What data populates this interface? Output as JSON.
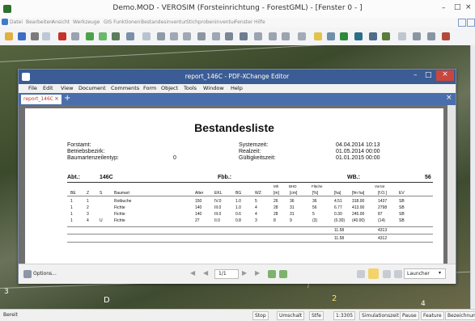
{
  "app": {
    "title": "Demo.MOD - VEROSIM (Forsteinrichtung - ForestGML) - [Fenster 0 - ]",
    "menu": [
      "Datei",
      "Bearbeiten",
      "Ansicht",
      "Werkzeuge",
      "GIS Funktionen",
      "Bestandesinventur",
      "Stichprobeninventur",
      "Fenster",
      "Hilfe"
    ],
    "status": {
      "left": "Bereit",
      "cells": [
        "Stop",
        "Umschalt",
        "Stfe",
        "1:3305",
        "Simulationszeit",
        "Pause",
        "Feature",
        "Bezeichnun"
      ]
    }
  },
  "map": {
    "labels": [
      "D",
      "2",
      "3",
      "4"
    ]
  },
  "pdf": {
    "title": "report_146C - PDF-XChange Editor",
    "menu": [
      "File",
      "Edit",
      "View",
      "Document",
      "Comments",
      "Form",
      "Object",
      "Tools",
      "Window",
      "Help"
    ],
    "tab_label": "report_146C",
    "statusbar": {
      "options_label": "Options...",
      "page_indicator": "1/1",
      "launch_label": "Launcher"
    },
    "report": {
      "heading": "Bestandesliste",
      "left_labels": [
        "Forstamt:",
        "Betriebsbezirk:",
        "Baumartenzeilentyp:"
      ],
      "baumartenzeilentyp_value": "0",
      "mid_labels": [
        "Systemzeit:",
        "Realzeit:",
        "Gültigkeitszeit:"
      ],
      "right_values": [
        "04.04.2014 10:13",
        "01.05.2014 00:00",
        "01.01.2015 00:00"
      ],
      "abt_label": "Abt.:",
      "abt_value": "146C",
      "fbb_label": "Fbb.:",
      "wb_label": "WB.:",
      "wb_value": "56",
      "col_units": [
        "Mh",
        "BHD",
        "Fläche",
        "Vorrat"
      ],
      "col_units2": [
        "[m]",
        "[cm]",
        "[%]",
        "[ha]",
        "[fm ha]",
        "[f.O.]"
      ],
      "columns": [
        "BE",
        "Z",
        "S",
        "Baumart",
        "Alter",
        "EKL",
        "BG",
        "WZ",
        "",
        "",
        "",
        "",
        "",
        "",
        "EV"
      ],
      "rows": [
        [
          "1",
          "1",
          "",
          "Rotbuche",
          "150",
          "IV.0",
          "1.0",
          "5",
          "26",
          "36",
          "36",
          "4.51",
          "318.00",
          "1437",
          "SB"
        ],
        [
          "1",
          "2",
          "",
          "Fichte",
          "140",
          "III.0",
          "1.0",
          "4",
          "28",
          "31",
          "56",
          "6.77",
          "413.00",
          "2798",
          "SB"
        ],
        [
          "1",
          "3",
          "",
          "Fichte",
          "140",
          "III.0",
          "0.6",
          "4",
          "28",
          "31",
          "5",
          "0.30",
          "245.00",
          "87",
          "SB"
        ],
        [
          "1",
          "4",
          "U",
          "Fichte",
          "27",
          "II.0",
          "0.8",
          "3",
          "8",
          "9",
          "(3)",
          "(0.30)",
          "(40.00)",
          "(14)",
          "SB"
        ]
      ],
      "totals": [
        [
          "11.58",
          "4313"
        ],
        [
          "11.58",
          "4312"
        ]
      ]
    }
  }
}
